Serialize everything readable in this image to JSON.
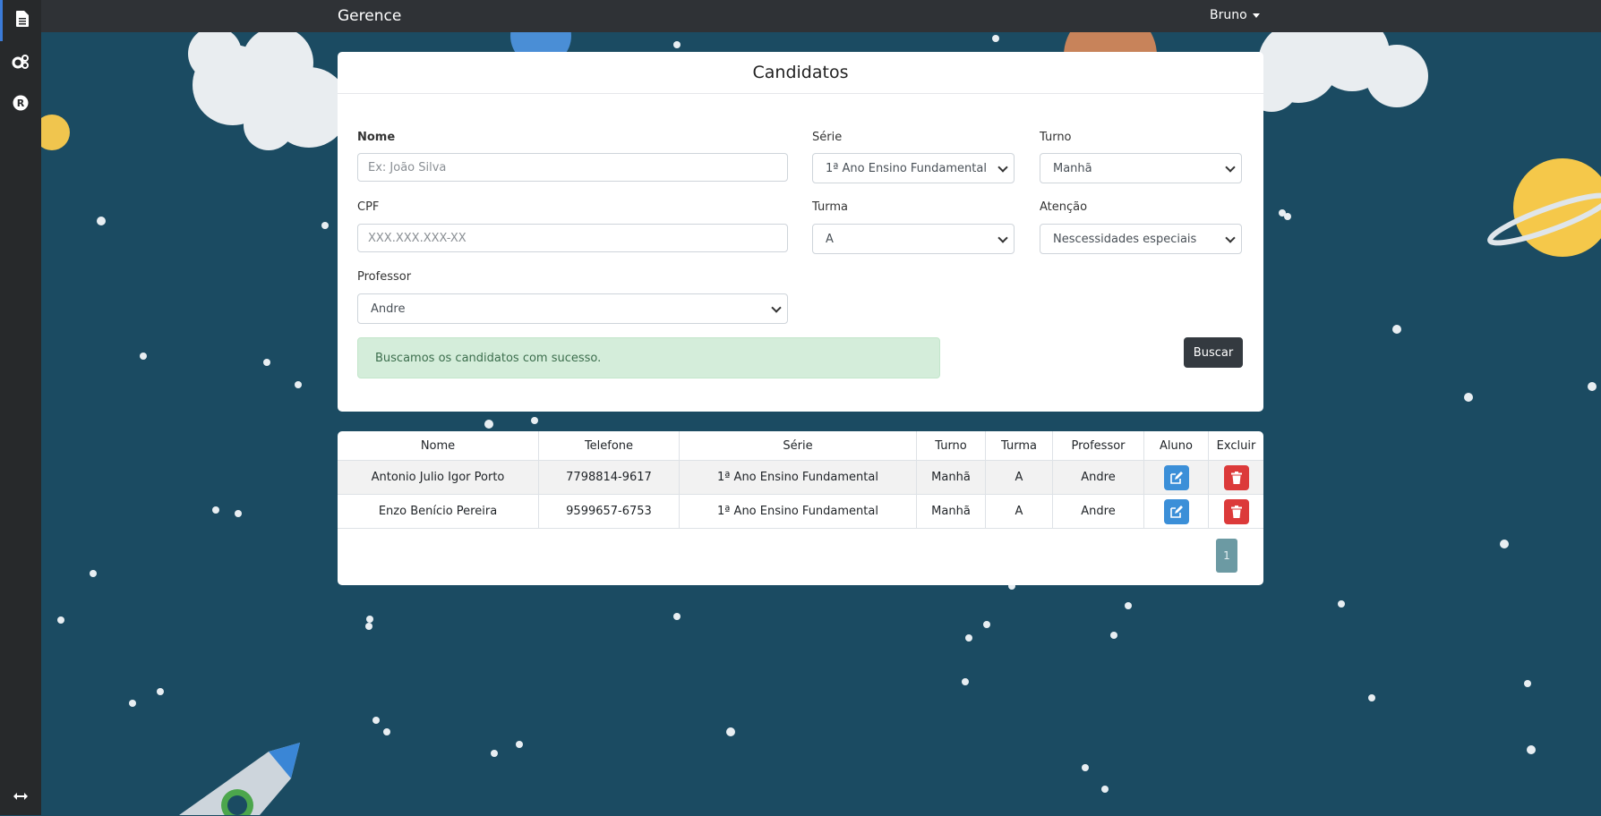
{
  "topbar": {
    "brand": "Gerence",
    "user_name": "Bruno"
  },
  "sidebar": {
    "items": [
      {
        "icon": "document-icon",
        "active": true
      },
      {
        "icon": "gears-icon",
        "active": false
      },
      {
        "icon": "registered-icon",
        "active": false
      }
    ],
    "bottom_icon": "arrows-horizontal-icon"
  },
  "form": {
    "title": "Candidatos",
    "nome": {
      "label": "Nome",
      "placeholder": "Ex: João Silva",
      "value": ""
    },
    "cpf": {
      "label": "CPF",
      "placeholder": "XXX.XXX.XXX-XX",
      "value": ""
    },
    "professor": {
      "label": "Professor",
      "value": "Andre"
    },
    "serie": {
      "label": "Série",
      "value": "1ª Ano Ensino Fundamental"
    },
    "turma": {
      "label": "Turma",
      "value": "A"
    },
    "turno": {
      "label": "Turno",
      "value": "Manhã"
    },
    "atencao": {
      "label": "Atenção",
      "value": "Nescessidades especiais"
    },
    "alert": "Buscamos os candidatos com sucesso.",
    "search_button": "Buscar"
  },
  "table": {
    "headers": [
      "Nome",
      "Telefone",
      "Série",
      "Turno",
      "Turma",
      "Professor",
      "Aluno",
      "Excluir"
    ],
    "rows": [
      {
        "nome": "Antonio Julio Igor Porto",
        "telefone": "7798814-9617",
        "serie": "1ª Ano Ensino Fundamental",
        "turno": "Manhã",
        "turma": "A",
        "professor": "Andre"
      },
      {
        "nome": "Enzo Benício Pereira",
        "telefone": "9599657-6753",
        "serie": "1ª Ano Ensino Fundamental",
        "turno": "Manhã",
        "turma": "A",
        "professor": "Andre"
      }
    ],
    "pagination": {
      "current_page": "1"
    }
  },
  "colors": {
    "background": "#1b4b62",
    "sidebar": "#27292b",
    "topbar": "#2f3236",
    "edit_button": "#3b8fd8",
    "delete_button": "#dc3a3a",
    "alert_bg": "#d4edda",
    "dark_button": "#343a40"
  }
}
